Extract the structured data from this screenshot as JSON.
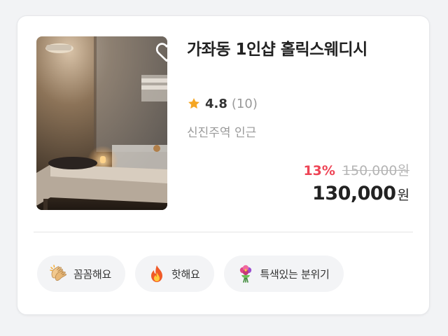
{
  "listing": {
    "title": "가좌동 1인샵 홀릭스웨디시",
    "rating": "4.8",
    "review_count": "(10)",
    "location": "신진주역 인근",
    "discount": "13%",
    "original_price": "150,000원",
    "price": "130,000",
    "currency": "원",
    "favorite": false
  },
  "tags": [
    {
      "label": "꼼꼼해요",
      "icon": "clapping-hands-icon"
    },
    {
      "label": "핫해요",
      "icon": "fire-icon"
    },
    {
      "label": "특색있는 분위기",
      "icon": "flower-bouquet-icon"
    }
  ],
  "colors": {
    "discount": "#ee4455",
    "star": "#f5a623",
    "tag_bg": "#f3f4f6"
  }
}
